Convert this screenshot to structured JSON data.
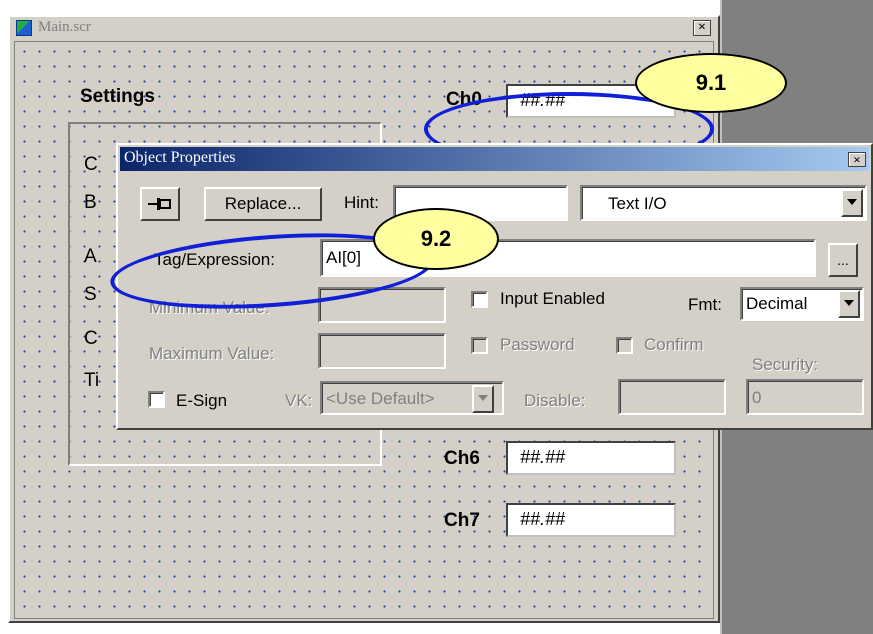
{
  "main_window": {
    "title": "Main.scr",
    "close_glyph": "×",
    "icon": "screen-app-icon"
  },
  "canvas": {
    "settings_label": "Settings",
    "panel_letters": [
      "C",
      "B",
      "A",
      "S",
      "C",
      "Ti"
    ],
    "channels": [
      {
        "label": "Ch0",
        "value": "##.##"
      },
      {
        "label": "Ch6",
        "value": "##.##"
      },
      {
        "label": "Ch7",
        "value": "##.##"
      }
    ]
  },
  "dialog": {
    "title": "Object Properties",
    "close_glyph": "×",
    "pin_icon": "pin-icon",
    "replace_button": "Replace...",
    "hint_label": "Hint:",
    "hint_value": "",
    "type_select": "Text I/O",
    "tag_label": "Tag/Expression:",
    "tag_value": "AI[0]",
    "browse_button": "...",
    "min_label": "Minimum Value:",
    "max_label": "Maximum Value:",
    "input_enabled": {
      "label": "Input Enabled",
      "checked": false
    },
    "password": {
      "label": "Password",
      "checked": false
    },
    "confirm": {
      "label": "Confirm",
      "checked": false
    },
    "fmt_label": "Fmt:",
    "fmt_value": "Decimal",
    "security_label": "Security:",
    "security_value": "0",
    "esign": {
      "label": "E-Sign",
      "checked": false
    },
    "vk_label": "VK:",
    "vk_value": "<Use Default>",
    "disable_label": "Disable:",
    "disable_value": ""
  },
  "callouts": [
    {
      "label": "9.1"
    },
    {
      "label": "9.2"
    }
  ],
  "colors": {
    "face": "#d4d0c8",
    "titlebar_active": "#0a246a",
    "callout_ring": "#1020d8",
    "callout_fill": "#ffffa0",
    "desktop": "#808080"
  }
}
